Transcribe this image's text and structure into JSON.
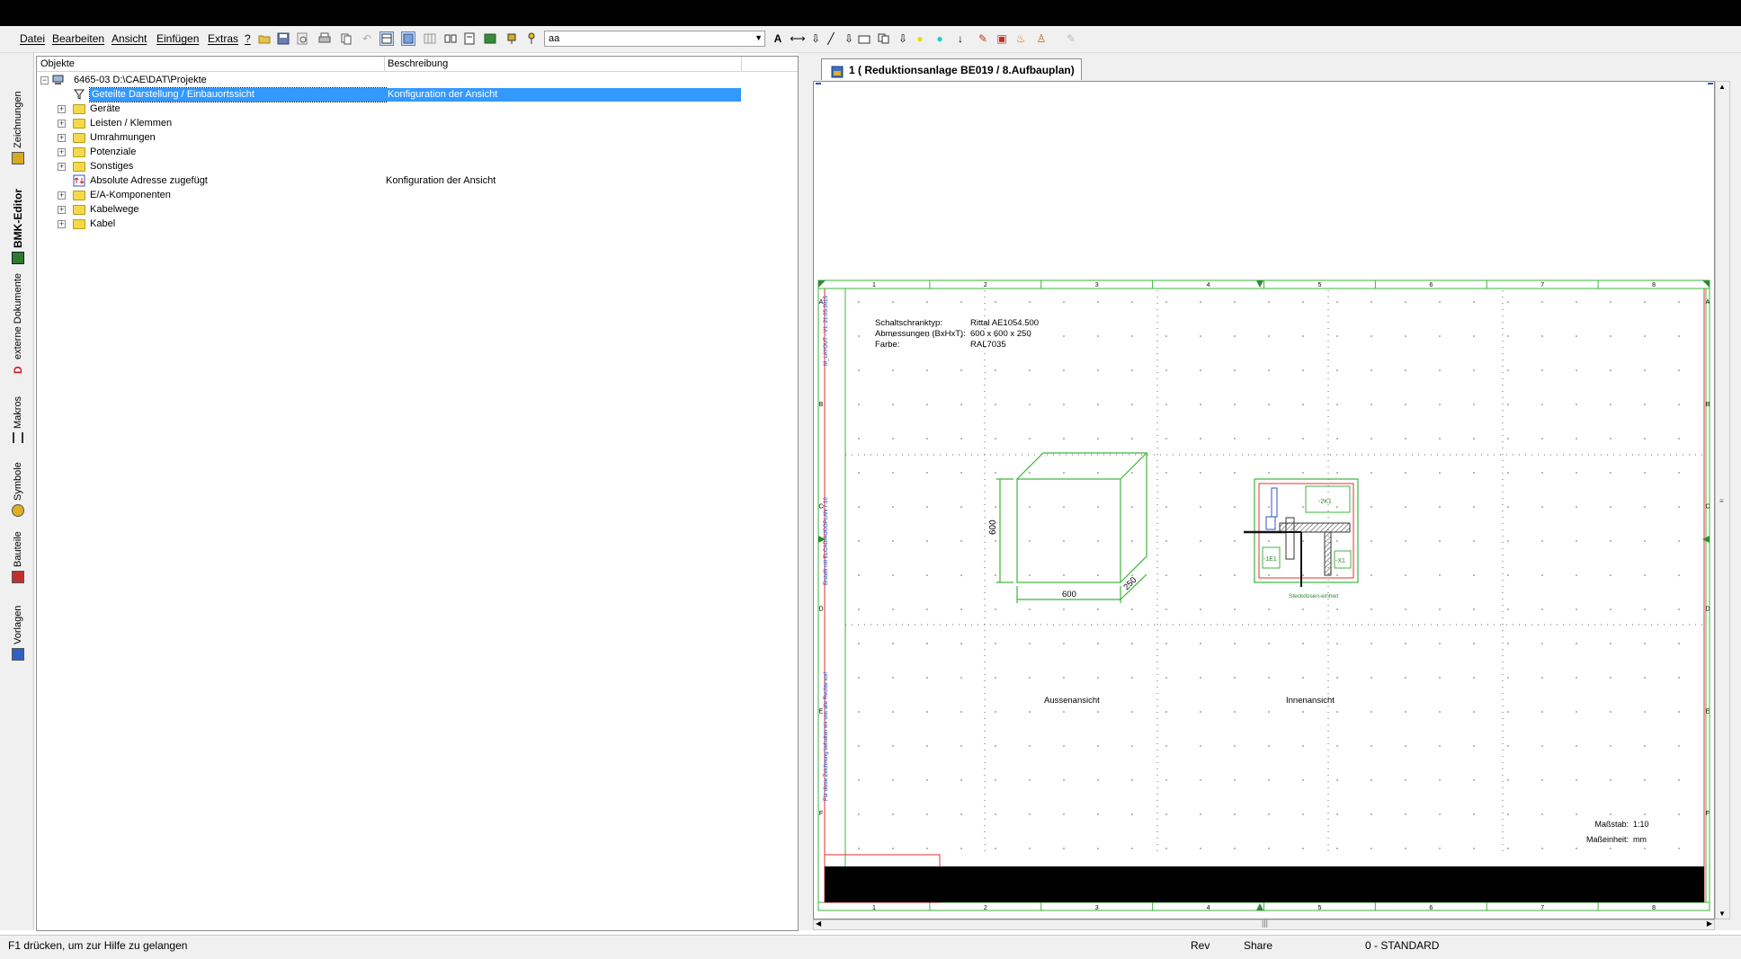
{
  "menubar": {
    "items": [
      "Datei",
      "Bearbeiten",
      "Ansicht",
      "Einfügen",
      "Extras",
      "?"
    ],
    "combo_value": "aa",
    "toolbar_icons": [
      "open-folder-icon",
      "save-icon",
      "print-preview-icon",
      "print-icon",
      "copy-icon",
      "undo-icon",
      "split-view-icon",
      "overview-icon",
      "grid-icon",
      "numbering-icon",
      "report-icon",
      "export-icon",
      "plug-icon",
      "key-icon"
    ],
    "right_toolbar_icons": [
      "text-icon",
      "dimension-icon",
      "insert-icon",
      "line-icon",
      "insert-arrow-icon",
      "rectangle-icon",
      "copy-doc-icon",
      "insert2-icon",
      "yellow-dot-icon",
      "cyan-dot-icon",
      "arrow-down-icon",
      "tool-icon",
      "connector-icon",
      "flame-icon",
      "person-icon",
      "disabled-pen-icon"
    ]
  },
  "sidetabs": [
    {
      "label": "Zeichnungen",
      "icon": "drawings-icon"
    },
    {
      "label": "BMK-Editor",
      "icon": "bmk-editor-icon",
      "active": true
    },
    {
      "label": "externe Dokumente",
      "icon": "external-docs-icon"
    },
    {
      "label": "Makros",
      "icon": "macros-icon"
    },
    {
      "label": "Symbole",
      "icon": "symbols-icon"
    },
    {
      "label": "Bauteile",
      "icon": "components-icon"
    },
    {
      "label": "Vorlagen",
      "icon": "templates-icon"
    }
  ],
  "tree": {
    "col_objects": "Objekte",
    "col_description": "Beschreibung",
    "root": "6465-03 D:\\CAE\\DAT\\Projekte",
    "rows": [
      {
        "label": "Geteilte Darstellung / Einbauortssicht",
        "desc": "Konfiguration der Ansicht",
        "selected": true,
        "icon": "filter-icon",
        "expander": false
      },
      {
        "label": "Geräte",
        "desc": "",
        "icon": "folder-icon",
        "expander": true
      },
      {
        "label": "Leisten / Klemmen",
        "desc": "",
        "icon": "folder-icon",
        "expander": true
      },
      {
        "label": "Umrahmungen",
        "desc": "",
        "icon": "folder-icon",
        "expander": true
      },
      {
        "label": "Potenziale",
        "desc": "",
        "icon": "folder-icon",
        "expander": true
      },
      {
        "label": "Sonstiges",
        "desc": "",
        "icon": "folder-icon",
        "expander": true
      },
      {
        "label": "Absolute Adresse zugefügt",
        "desc": "Konfiguration der Ansicht",
        "icon": "address-icon",
        "expander": false
      },
      {
        "label": "E/A-Komponenten",
        "desc": "",
        "icon": "folder-icon",
        "expander": true
      },
      {
        "label": "Kabelwege",
        "desc": "",
        "icon": "folder-icon",
        "expander": true
      },
      {
        "label": "Kabel",
        "desc": "",
        "icon": "folder-icon",
        "expander": true
      }
    ]
  },
  "document_tab": {
    "title": "1 ( Reduktionsanlage BE019  / 8.Aufbauplan)"
  },
  "drawing": {
    "col_numbers": [
      "1",
      "2",
      "3",
      "4",
      "5",
      "6",
      "7",
      "8"
    ],
    "row_letters": [
      "A",
      "B",
      "C",
      "D",
      "E",
      "F"
    ],
    "info_labels": [
      "Schaltschranktyp:",
      "Abmessungen (BxHxT):",
      "Farbe:"
    ],
    "info_values": [
      "Rittal AE1054.500",
      "600 x 600 x 250",
      "RAL7035"
    ],
    "dim_height": "600",
    "dim_width": "600",
    "dim_depth": "250",
    "outer_view_label": "Aussenansicht",
    "inner_view_label": "Innenansicht",
    "inner_labels": {
      "k1": "-2K1",
      "e1": "-1E1",
      "x1": "-X1",
      "socket": "Steckdosen-einheit"
    },
    "side_text_1": "Für diese Zeichnung behalten wir uns alle Rechte vor!",
    "side_text_2": "Erstellt mit ELCAD/AUCOPLAN 7.10",
    "side_text_3": "M_LAYOUT - V1: 21.05.2015",
    "scale_label": "Maßstab:",
    "scale_value": "1:10",
    "unit_label": "Maßeinheit:",
    "unit_value": "mm"
  },
  "statusbar": {
    "help": "F1 drücken, um zur Hilfe zu gelangen",
    "rev": "Rev",
    "share": "Share",
    "layer": "0 - STANDARD"
  }
}
